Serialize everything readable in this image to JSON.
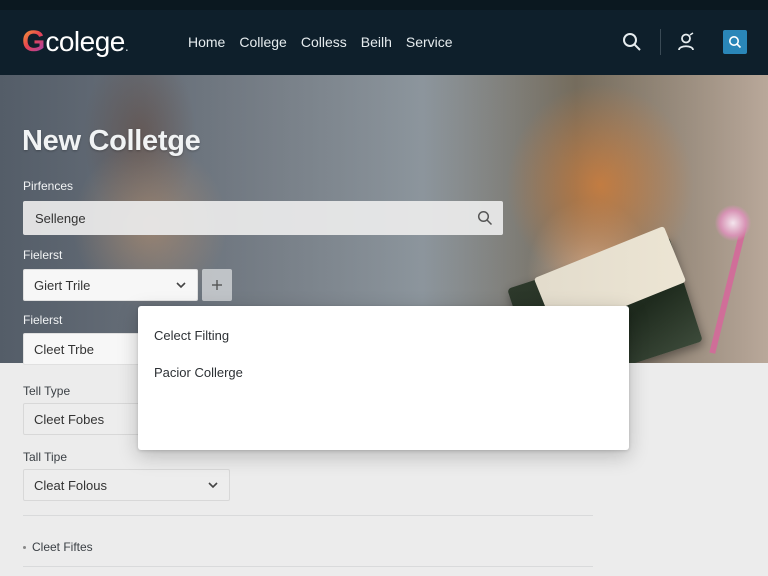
{
  "header": {
    "logo_mark": "G",
    "logo_text": "colege",
    "logo_dot": ".",
    "nav": [
      "Home",
      "College",
      "Colless",
      "Beilh",
      "Service"
    ],
    "icons": [
      "search-icon",
      "user-icon",
      "search-icon"
    ],
    "accent_color": "#2a86b8"
  },
  "hero": {
    "title": "New Colletge",
    "search_label": "Pirfences",
    "search_value": "Sellenge",
    "filter1_label": "Fielerst",
    "filter1_value": "Giert Trile"
  },
  "form": {
    "filter2_label": "Fielerst",
    "filter2_value": "Cleet Trbe",
    "tall_type_label": "Tell Type",
    "tall_type_value": "Cleet Fobes",
    "tall_tipe_label": "Tall Tipe",
    "tall_tipe_value": "Cleat Folous",
    "footer_item": "Cleet Fiftes"
  },
  "dropdown": {
    "options": [
      "Celect Filting",
      "Pacior Collerge"
    ]
  }
}
